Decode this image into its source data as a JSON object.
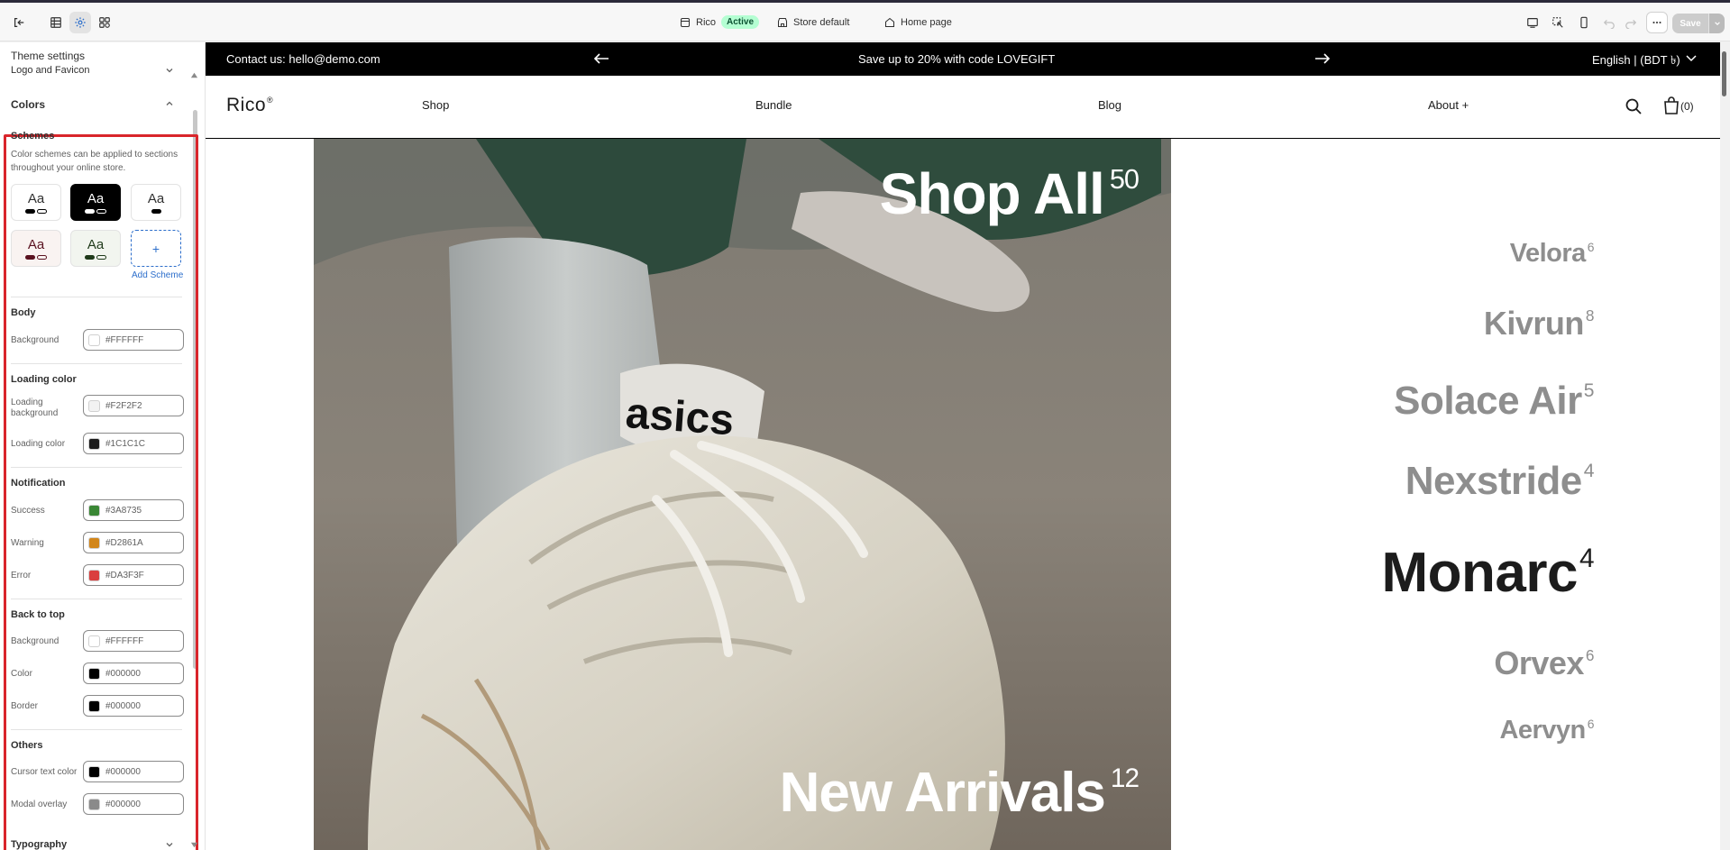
{
  "topbar": {
    "theme_name": "Rico",
    "status_badge": "Active",
    "store_label": "Store default",
    "page_label": "Home page",
    "save_label": "Save"
  },
  "sidebar": {
    "title": "Theme settings",
    "logo_section": "Logo and Favicon",
    "colors_section": "Colors",
    "schemes_heading": "Schemes",
    "schemes_desc": "Color schemes can be applied to sections throughout your online store.",
    "scheme_sample": "Aa",
    "add_scheme_icon": "+",
    "add_scheme_label": "Add Scheme",
    "body": {
      "heading": "Body",
      "background_label": "Background",
      "background_value": "#FFFFFF"
    },
    "loading": {
      "heading": "Loading color",
      "bg_label": "Loading background",
      "bg_value": "#F2F2F2",
      "color_label": "Loading color",
      "color_value": "#1C1C1C"
    },
    "notification": {
      "heading": "Notification",
      "success_label": "Success",
      "success_value": "#3A8735",
      "warning_label": "Warning",
      "warning_value": "#D2861A",
      "error_label": "Error",
      "error_value": "#DA3F3F"
    },
    "back_to_top": {
      "heading": "Back to top",
      "bg_label": "Background",
      "bg_value": "#FFFFFF",
      "color_label": "Color",
      "color_value": "#000000",
      "border_label": "Border",
      "border_value": "#000000"
    },
    "others": {
      "heading": "Others",
      "cursor_label": "Cursor text color",
      "cursor_value": "#000000",
      "overlay_label": "Modal overlay",
      "overlay_value": "#000000"
    },
    "typography_section": "Typography"
  },
  "store": {
    "announcement_contact": "Contact us: hello@demo.com",
    "announcement_promo": "Save up to 20% with code LOVEGIFT",
    "locale": "English | (BDT ৳)",
    "logo": "Rico",
    "logo_mark": "®",
    "nav": [
      "Shop",
      "Bundle",
      "Blog",
      "About +"
    ],
    "cart_count": "(0)",
    "hero": {
      "shop_all": "Shop All",
      "shop_all_count": "50",
      "new_arrivals": "New Arrivals",
      "new_arrivals_count": "12",
      "products": [
        {
          "name": "Velora",
          "count": "6"
        },
        {
          "name": "Kivrun",
          "count": "8"
        },
        {
          "name": "Solace Air",
          "count": "5"
        },
        {
          "name": "Nexstride",
          "count": "4"
        },
        {
          "name": "Monarc",
          "count": "4"
        },
        {
          "name": "Orvex",
          "count": "6"
        },
        {
          "name": "Aervyn",
          "count": "6"
        }
      ]
    }
  },
  "colors": {
    "accent": "#2c6ecb",
    "highlight_frame": "#d9252b"
  }
}
